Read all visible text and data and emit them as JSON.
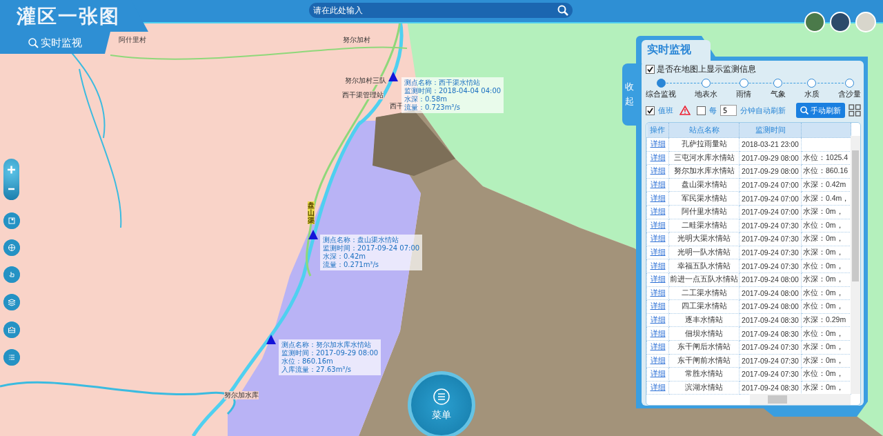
{
  "header": {
    "title": "灌区一张图",
    "mode_tab": "实时监视",
    "search": {
      "placeholder": "请在此处输入"
    }
  },
  "map": {
    "labels": [
      {
        "text": "阿什里村"
      },
      {
        "text": "努尔加村"
      },
      {
        "text": "努尔加村三队"
      },
      {
        "text": "西干渠管理站"
      },
      {
        "text": "西干"
      },
      {
        "text": "盘山渠"
      },
      {
        "text": "努尔加水库"
      }
    ],
    "stations": [
      {
        "lines": [
          "测点名称：西干渠水情站",
          "监测时间：2018-04-04 04:00",
          "水深：0.58m",
          "流量：0.723m³/s"
        ]
      },
      {
        "lines": [
          "测点名称：盘山渠水情站",
          "监测时间：2017-09-24 07:00",
          "水深：0.42m",
          "流量：0.271m³/s"
        ]
      },
      {
        "lines": [
          "测点名称：努尔加水库水情站",
          "监测时间：2017-09-29 08:00",
          "水位：860.16m",
          "入库流量：27.63m³/s"
        ]
      }
    ]
  },
  "panel": {
    "title": "实时监视",
    "collapse": "收起",
    "show_on_map": {
      "label": "是否在地图上显示监测信息",
      "checked": true
    },
    "steps": [
      {
        "label": "综合监视",
        "selected": true
      },
      {
        "label": "地表水",
        "selected": false
      },
      {
        "label": "雨情",
        "selected": false
      },
      {
        "label": "气象",
        "selected": false
      },
      {
        "label": "水质",
        "selected": false
      },
      {
        "label": "含沙量",
        "selected": false
      }
    ],
    "duty": {
      "label": "值班",
      "checked": true
    },
    "auto_refresh": {
      "prefix": "每",
      "checked": false,
      "value": "5",
      "suffix": "分钟自动刷新"
    },
    "refresh_button": "手动刷新",
    "table": {
      "columns": [
        "操作",
        "站点名称",
        "监测时间"
      ],
      "rows": [
        {
          "action": "详细",
          "station": "孔萨拉雨量站",
          "time": "2018-03-21 23:00"
        },
        {
          "action": "详细",
          "station": "三屯河水库水情站",
          "time": "2017-09-29 08:00",
          "reading": "水位：1025.4"
        },
        {
          "action": "详细",
          "station": "努尔加水库水情站",
          "time": "2017-09-29 08:00",
          "reading": "水位：860.16"
        },
        {
          "action": "详细",
          "station": "盘山渠水情站",
          "time": "2017-09-24 07:00",
          "reading": "水深：0.42m"
        },
        {
          "action": "详细",
          "station": "军民渠水情站",
          "time": "2017-09-24 07:00",
          "reading": "水深：0.4m，"
        },
        {
          "action": "详细",
          "station": "阿什里水情站",
          "time": "2017-09-24 07:00",
          "reading": "水深：0m，"
        },
        {
          "action": "详细",
          "station": "二畦渠水情站",
          "time": "2017-09-24 07:30",
          "reading": "水位：0m，"
        },
        {
          "action": "详细",
          "station": "光明大渠水情站",
          "time": "2017-09-24 07:30",
          "reading": "水深：0m，"
        },
        {
          "action": "详细",
          "station": "光明一队水情站",
          "time": "2017-09-24 07:30",
          "reading": "水深：0m，"
        },
        {
          "action": "详细",
          "station": "幸福五队水情站",
          "time": "2017-09-24 07:30",
          "reading": "水位：0m，"
        },
        {
          "action": "详细",
          "station": "前进一点五队水情站",
          "time": "2017-09-24 08:00",
          "reading": "水深：0m，"
        },
        {
          "action": "详细",
          "station": "二工渠水情站",
          "time": "2017-09-24 08:00",
          "reading": "水位：0m，"
        },
        {
          "action": "详细",
          "station": "四工渠水情站",
          "time": "2017-09-24 08:00",
          "reading": "水位：0m，"
        },
        {
          "action": "详细",
          "station": "逐丰水情站",
          "time": "2017-09-24 08:30",
          "reading": "水深：0.29m"
        },
        {
          "action": "详细",
          "station": "佃坝水情站",
          "time": "2017-09-24 08:30",
          "reading": "水位：0m，"
        },
        {
          "action": "详细",
          "station": "东干闸后水情站",
          "time": "2017-09-24 07:30",
          "reading": "水深：0m，"
        },
        {
          "action": "详细",
          "station": "东干闸前水情站",
          "time": "2017-09-24 07:30",
          "reading": "水深：0m，"
        },
        {
          "action": "详细",
          "station": "常胜水情站",
          "time": "2017-09-24 07:30",
          "reading": "水位：0m，"
        },
        {
          "action": "详细",
          "station": "滨湖水情站",
          "time": "2017-09-24 08:30",
          "reading": "水深：0m，"
        }
      ]
    }
  },
  "menu_button": "菜单"
}
